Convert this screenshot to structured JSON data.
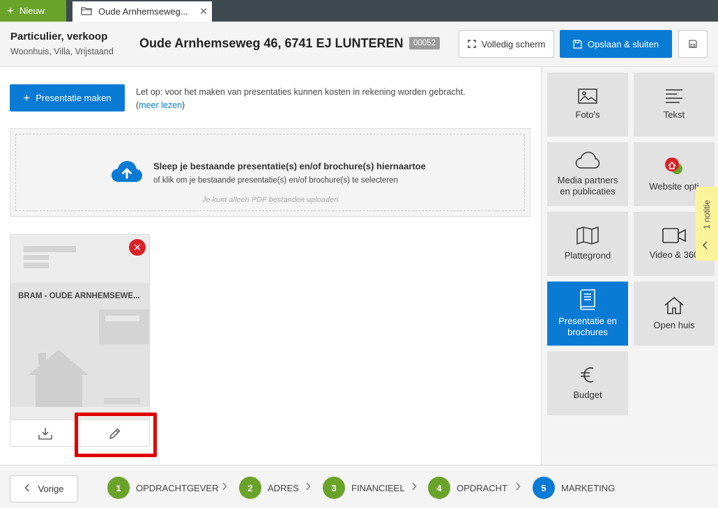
{
  "topbar": {
    "new_label": "Nieuw",
    "tab_title": "Oude Arnhemseweg...",
    "tab_close": "✕"
  },
  "header": {
    "type": "Particulier, verkoop",
    "subtype": "Woonhuis, Villa, Vrijstaand",
    "address": "Oude Arnhemseweg 46, 6741 EJ LUNTEREN",
    "badge": "00052",
    "fullscreen_label": "Volledig scherm",
    "save_close_label": "Opslaan & sluiten"
  },
  "main": {
    "create_label": "Presentatie maken",
    "notice_text": "Let op: voor het maken van presentaties kunnen kosten in rekening worden gebracht.",
    "notice_paren_open": "(",
    "notice_link": "meer lezen",
    "notice_paren_close": ")",
    "dropzone_title": "Sleep je bestaande presentatie(s) en/of brochure(s) hiernaartoe",
    "dropzone_sub": "of klik om je bestaande presentatie(s) en/of brochure(s) te selecteren",
    "dropzone_hint": "Je kunt alleen PDF bestanden uploaden",
    "card_title": "BRAM - OUDE ARNHEMSEWE...",
    "card_delete": "✕"
  },
  "sidebar": {
    "tiles": [
      {
        "label": "Foto's",
        "icon": "image-icon"
      },
      {
        "label": "Tekst",
        "icon": "text-lines-icon"
      },
      {
        "label": "Media partners\nen publicaties",
        "icon": "cloud-icon"
      },
      {
        "label": "Website opti",
        "icon": "website-icon"
      },
      {
        "label": "Plattegrond",
        "icon": "map-icon"
      },
      {
        "label": "Video & 360",
        "icon": "video-icon"
      },
      {
        "label": "Presentatie en\nbrochures",
        "icon": "book-icon"
      },
      {
        "label": "Open huis",
        "icon": "house-icon"
      },
      {
        "label": "Budget",
        "icon": "euro-icon"
      }
    ],
    "note_label": "1 notitie"
  },
  "footer": {
    "prev_label": "Vorige",
    "steps": [
      {
        "num": "1",
        "label": "OPDRACHTGEVER"
      },
      {
        "num": "2",
        "label": "ADRES"
      },
      {
        "num": "3",
        "label": "FINANCIEEL"
      },
      {
        "num": "4",
        "label": "OPDRACHT"
      },
      {
        "num": "5",
        "label": "MARKETING"
      }
    ]
  },
  "colors": {
    "primary": "#0a7bd4",
    "success": "#6aa32a",
    "danger": "#d8232a",
    "note": "#fbf39a"
  }
}
